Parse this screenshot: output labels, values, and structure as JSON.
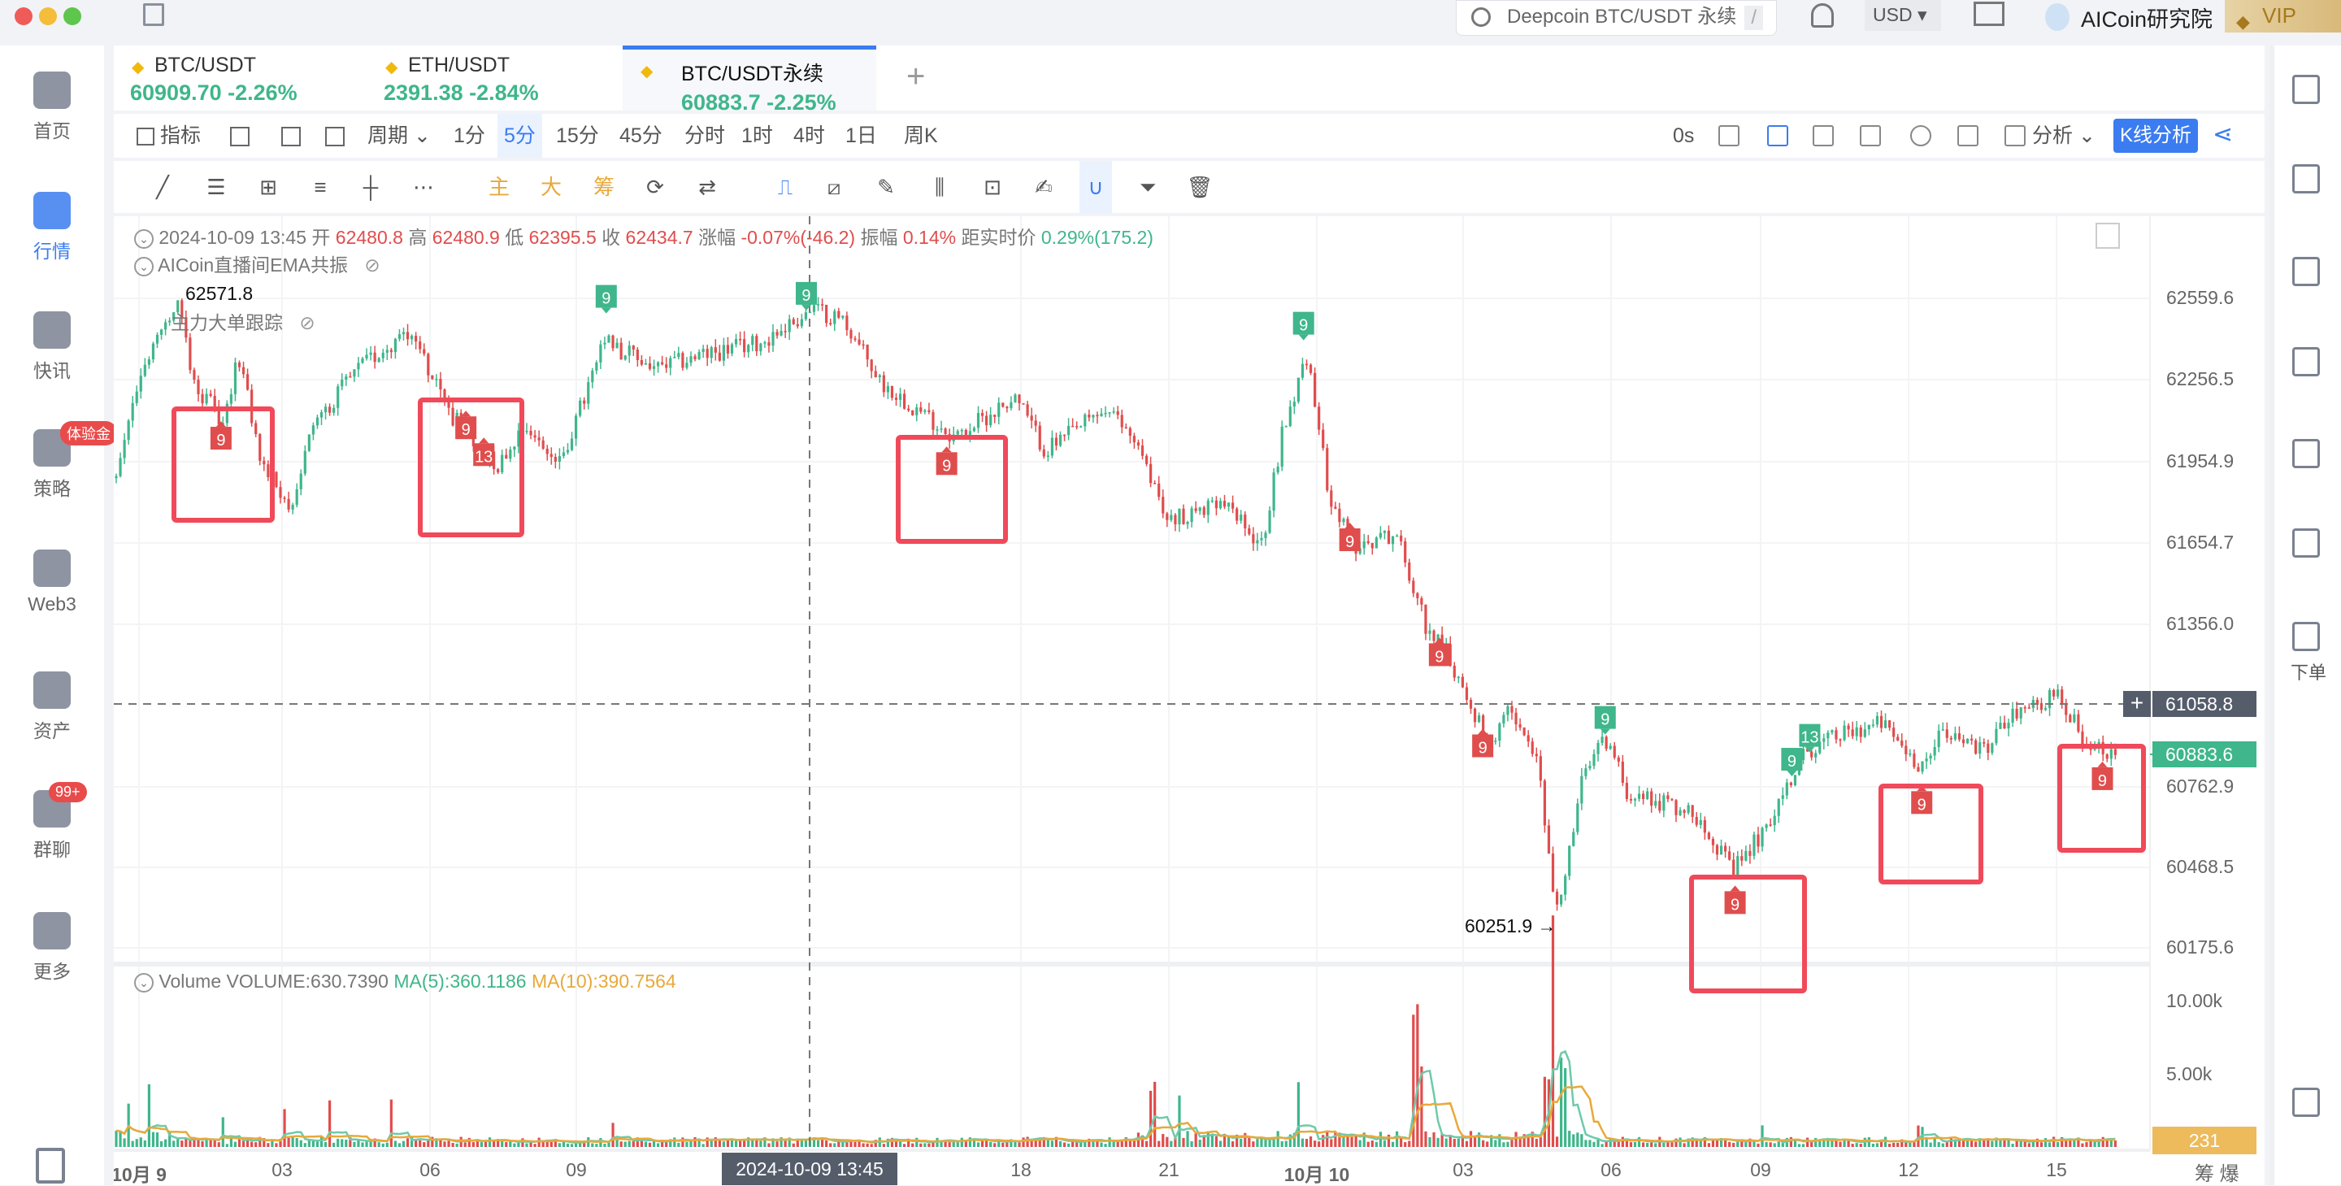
{
  "window": {
    "traffic_lights": [
      "#ee5b58",
      "#f4bd3a",
      "#5ec54d"
    ]
  },
  "topbar": {
    "search_placeholder": "Deepcoin BTC/USDT 永续",
    "search_shortcut": "/",
    "currency": "USD",
    "username": "AICoin研究院",
    "vip": "VIP"
  },
  "sidebar": {
    "items": [
      {
        "label": "首页"
      },
      {
        "label": "行情",
        "active": true
      },
      {
        "label": "快讯"
      },
      {
        "label": "策略",
        "badge": "体验金"
      },
      {
        "label": "Web3"
      },
      {
        "label": "资产"
      },
      {
        "label": "群聊",
        "badge": "99+"
      },
      {
        "label": "更多"
      }
    ]
  },
  "right_sidebar": {
    "order_label": "下单"
  },
  "tabs": [
    {
      "name": "BTC/USDT",
      "price": "60909.70",
      "change": "-2.26%"
    },
    {
      "name": "ETH/USDT",
      "price": "2391.38",
      "change": "-2.84%"
    },
    {
      "name": "BTC/USDT永续",
      "price": "60883.7",
      "change": "-2.25%",
      "active": true
    }
  ],
  "toolbar": {
    "indicators": "指标",
    "period": "周期",
    "periods": [
      "1分",
      "5分",
      "15分",
      "45分",
      "分时",
      "1时",
      "4时",
      "1日",
      "周K"
    ],
    "active_period": "5分",
    "countdown": "0s",
    "analysis": "分析",
    "kline_analysis": "K线分析",
    "main": "主",
    "big": "大",
    "chips": "筹"
  },
  "ohlc": {
    "datetime": "2024-10-09 13:45",
    "open_label": "开",
    "open": "62480.8",
    "high_label": "高",
    "high": "62480.9",
    "low_label": "低",
    "low": "62395.5",
    "close_label": "收",
    "close": "62434.7",
    "change_label": "涨幅",
    "change": "-0.07%(-46.2)",
    "amp_label": "振幅",
    "amp": "0.14%",
    "dist_label": "距实时价",
    "dist": "0.29%(175.2)"
  },
  "indicators": {
    "ema": "AICoin直播间EMA共振",
    "bigorder": "主力大单跟踪"
  },
  "price_axis": [
    "62559.6",
    "62256.5",
    "61954.9",
    "61654.7",
    "61356.0",
    "60762.9",
    "60468.5",
    "60175.6"
  ],
  "crosshair": {
    "price": "61058.8",
    "time": "2024-10-09 13:45"
  },
  "last_price": "60883.6",
  "high_mark": "62571.8",
  "low_mark": "60251.9 →",
  "markers": [
    {
      "label": "9",
      "side": "top"
    },
    {
      "label": "9",
      "side": "top"
    },
    {
      "label": "9",
      "side": "top"
    },
    {
      "label": "9",
      "side": "top"
    },
    {
      "label": "9",
      "side": "top"
    },
    {
      "label": "13",
      "side": "top"
    },
    {
      "label": "9",
      "side": "bottom"
    },
    {
      "label": "9",
      "side": "bottom"
    },
    {
      "label": "13",
      "side": "bottom"
    },
    {
      "label": "9",
      "side": "bottom"
    },
    {
      "label": "9",
      "side": "bottom"
    },
    {
      "label": "9",
      "side": "bottom"
    },
    {
      "label": "9",
      "side": "bottom"
    },
    {
      "label": "9",
      "side": "bottom"
    },
    {
      "label": "9",
      "side": "bottom"
    },
    {
      "label": "9",
      "side": "bottom"
    }
  ],
  "volume": {
    "title": "Volume",
    "value": "VOLUME:630.7390",
    "ma5": "MA(5):360.1186",
    "ma10": "MA(10):390.7564",
    "axis": [
      "10.00k",
      "5.00k"
    ],
    "last": "231"
  },
  "time_axis": [
    "10月 9",
    "03",
    "06",
    "09",
    "18",
    "21",
    "10月 10",
    "03",
    "06",
    "09",
    "12",
    "15"
  ],
  "bottom_right": [
    "筹",
    "爆"
  ],
  "colors": {
    "up": "#3fb68b",
    "down": "#e04d4d",
    "accent": "#3b7cf0",
    "highlight_box": "#f04a5a",
    "ma10": "#e8a93a"
  }
}
